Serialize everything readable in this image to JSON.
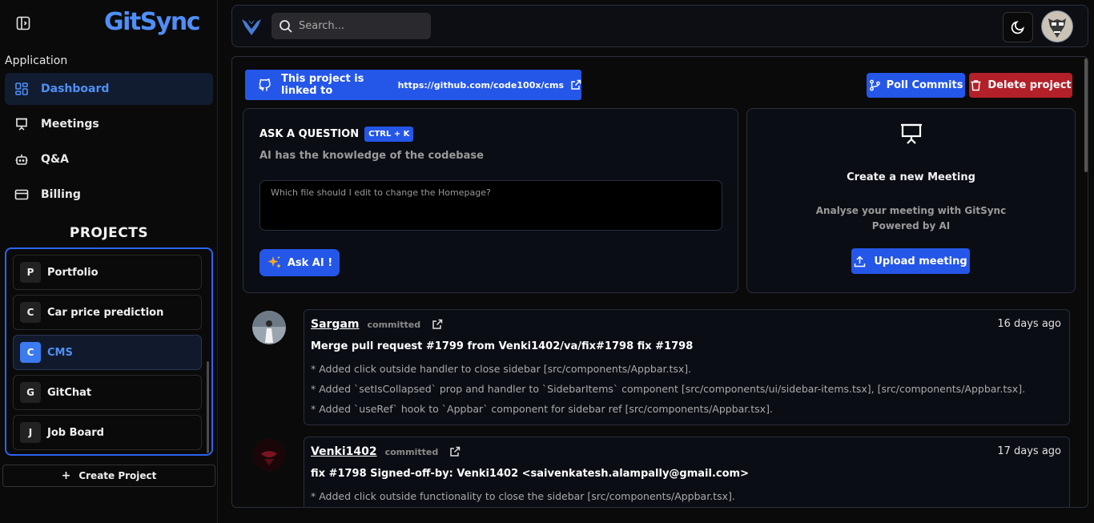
{
  "app": {
    "brand": "GitSync"
  },
  "sidebar": {
    "section_label": "Application",
    "items": [
      {
        "label": "Dashboard",
        "icon": "dashboard-icon",
        "active": true
      },
      {
        "label": "Meetings",
        "icon": "presentation-icon",
        "active": false
      },
      {
        "label": "Q&A",
        "icon": "bot-icon",
        "active": false
      },
      {
        "label": "Billing",
        "icon": "credit-card-icon",
        "active": false
      }
    ],
    "projects_title": "PROJECTS",
    "projects": [
      {
        "initial": "P",
        "name": "Portfolio",
        "active": false
      },
      {
        "initial": "C",
        "name": "Car price prediction",
        "active": false
      },
      {
        "initial": "C",
        "name": "CMS",
        "active": true
      },
      {
        "initial": "G",
        "name": "GitChat",
        "active": false
      },
      {
        "initial": "J",
        "name": "Job Board",
        "active": false
      }
    ],
    "create_label": "Create Project"
  },
  "topbar": {
    "search_placeholder": "Search..."
  },
  "banner": {
    "linked_text": "This project is linked to",
    "linked_url": "https://github.com/code100x/cms",
    "poll_label": "Poll Commits",
    "delete_label": "Delete project"
  },
  "ask": {
    "title": "ASK A QUESTION",
    "shortcut": "CTRL + K",
    "subtitle": "AI has the knowledge of the codebase",
    "placeholder": "Which file should I edit to change the Homepage?",
    "button_label": "Ask AI !"
  },
  "meeting": {
    "title": "Create a new Meeting",
    "subtitle_line1": "Analyse your meeting with GitSync",
    "subtitle_line2": "Powered by AI",
    "button_label": "Upload meeting"
  },
  "commits": [
    {
      "author": "Sargam",
      "tag": "committed",
      "time": "16 days ago",
      "message": "Merge pull request #1799 from Venki1402/va/fix#1798 fix #1798",
      "lines": [
        "* Added click outside handler to close sidebar [src/components/Appbar.tsx].",
        "* Added `setIsCollapsed` prop and handler to `SidebarItems` component [src/components/ui/sidebar-items.tsx], [src/components/Appbar.tsx].",
        "* Added `useRef` hook to `Appbar` component for sidebar ref [src/components/Appbar.tsx]."
      ]
    },
    {
      "author": "Venki1402",
      "tag": "committed",
      "time": "17 days ago",
      "message": "fix #1798 Signed-off-by: Venki1402 <saivenkatesh.alampally@gmail.com>",
      "lines": [
        "* Added click outside functionality to close the sidebar [src/components/Appbar.tsx]."
      ]
    }
  ],
  "colors": {
    "accent": "#2456e8",
    "brand": "#4f8ff7",
    "danger": "#b3202a",
    "background": "#0a0a0a"
  }
}
